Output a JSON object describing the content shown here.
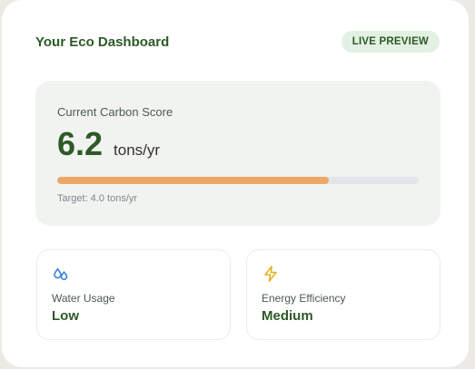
{
  "header": {
    "title": "Your Eco Dashboard",
    "badge": "LIVE PREVIEW"
  },
  "score": {
    "label": "Current Carbon Score",
    "value": "6.2",
    "unit": "tons/yr",
    "progress_percent": 75,
    "target": "Target: 4.0 tons/yr"
  },
  "metrics": [
    {
      "icon": "water-droplets-icon",
      "label": "Water Usage",
      "value": "Low"
    },
    {
      "icon": "lightning-bolt-icon",
      "label": "Energy Efficiency",
      "value": "Medium"
    }
  ],
  "colors": {
    "brand_green": "#2d5a27",
    "progress_fill": "#eca668",
    "progress_track": "#e2e6eb",
    "water_icon": "#3b82d6",
    "energy_icon": "#e3b021"
  }
}
